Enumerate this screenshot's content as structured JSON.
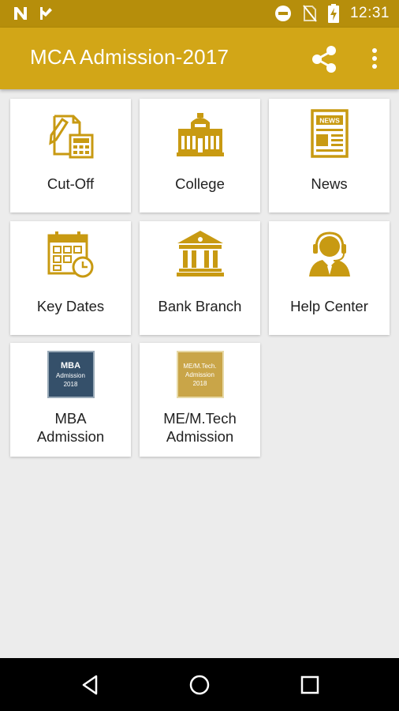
{
  "status_bar": {
    "time": "12:31",
    "icons": [
      "n-notification-icon",
      "flag-notification-icon",
      "do-not-disturb-icon",
      "no-sim-icon",
      "battery-charging-icon"
    ]
  },
  "app_bar": {
    "title": "MCA Admission-2017",
    "actions": [
      "share-icon",
      "more-vert-icon"
    ]
  },
  "tiles": [
    {
      "label": "Cut-Off",
      "icon": "cutoff-calculator-icon"
    },
    {
      "label": "College",
      "icon": "college-building-icon"
    },
    {
      "label": "News",
      "icon": "newspaper-icon"
    },
    {
      "label": "Key Dates",
      "icon": "calendar-clock-icon"
    },
    {
      "label": "Bank Branch",
      "icon": "bank-icon"
    },
    {
      "label": "Help Center",
      "icon": "headset-support-icon"
    },
    {
      "label_line1": "MBA",
      "label_line2": "Admission",
      "badge_line1": "MBA",
      "badge_line2": "Admission",
      "badge_line3": "2018"
    },
    {
      "label_line1": "ME/M.Tech",
      "label_line2": "Admission",
      "badge_line1": "ME/M.Tech.",
      "badge_line2": "Admission",
      "badge_line3": "2018"
    }
  ],
  "colors": {
    "status_bar": "#b68e0b",
    "app_bar": "#d2a617",
    "icon_gold": "#c89a12",
    "background": "#ececec"
  },
  "nav_bar": [
    "back-icon",
    "home-icon",
    "recents-icon"
  ]
}
